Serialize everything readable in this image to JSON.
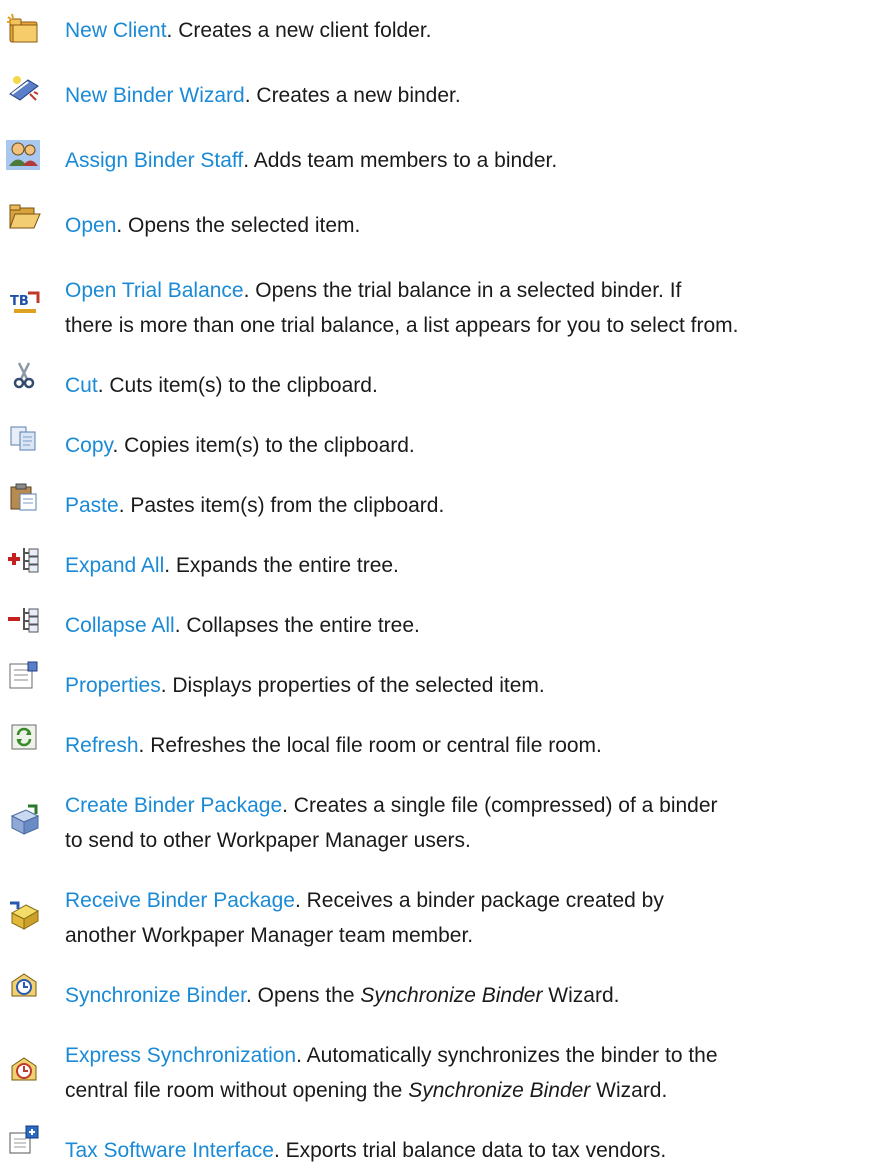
{
  "items": [
    {
      "term": "New Client",
      "desc": ". Creates a new client folder.",
      "icon": "new-client-folder-icon"
    },
    {
      "term": "New Binder Wizard",
      "desc": ". Creates a new binder.",
      "icon": "new-binder-wizard-icon"
    },
    {
      "term": "Assign Binder Staff",
      "desc": ". Adds team members to a binder.",
      "icon": "assign-staff-icon"
    },
    {
      "term": "Open",
      "desc": ". Opens the selected item.",
      "icon": "open-folder-icon"
    },
    {
      "term": "Open Trial Balance",
      "desc": ". Opens the trial balance in a selected binder. If",
      "desc2": "there is more than one trial balance, a list appears for you to select from.",
      "icon": "trial-balance-icon"
    },
    {
      "term": "Cut",
      "desc": ". Cuts item(s) to the clipboard.",
      "icon": "scissors-icon"
    },
    {
      "term": "Copy",
      "desc": ". Copies item(s) to the clipboard.",
      "icon": "copy-icon"
    },
    {
      "term": "Paste",
      "desc": ". Pastes item(s) from the clipboard.",
      "icon": "paste-icon"
    },
    {
      "term": "Expand All",
      "desc": ". Expands the entire tree.",
      "icon": "expand-tree-icon"
    },
    {
      "term": "Collapse All",
      "desc": ". Collapses the entire tree.",
      "icon": "collapse-tree-icon"
    },
    {
      "term": "Properties",
      "desc": ". Displays properties of the selected item.",
      "icon": "properties-icon"
    },
    {
      "term": "Refresh",
      "desc": ". Refreshes the local file room or central file room.",
      "icon": "refresh-icon"
    },
    {
      "term": "Create Binder Package",
      "desc": ". Creates a single file (compressed) of a binder",
      "desc2": "to send to other Workpaper Manager users.",
      "icon": "create-package-icon"
    },
    {
      "term": "Receive Binder Package",
      "desc": ". Receives a binder package created by",
      "desc2": "another Workpaper Manager team member.",
      "icon": "receive-package-icon"
    },
    {
      "term": "Synchronize Binder",
      "desc": ". Opens the ",
      "desc_italic": "Synchronize Binder",
      "desc_after": " Wizard.",
      "icon": "synchronize-binder-icon"
    },
    {
      "term": "Express Synchronization",
      "desc": ". Automatically synchronizes the binder to the",
      "desc2": "central file room without opening the ",
      "desc2_italic": "Synchronize Binder",
      "desc2_after": " Wizard.",
      "icon": "express-sync-icon"
    },
    {
      "term": "Tax Software Interface",
      "desc": ". Exports trial balance data to tax vendors.",
      "icon": "tax-software-icon"
    }
  ]
}
